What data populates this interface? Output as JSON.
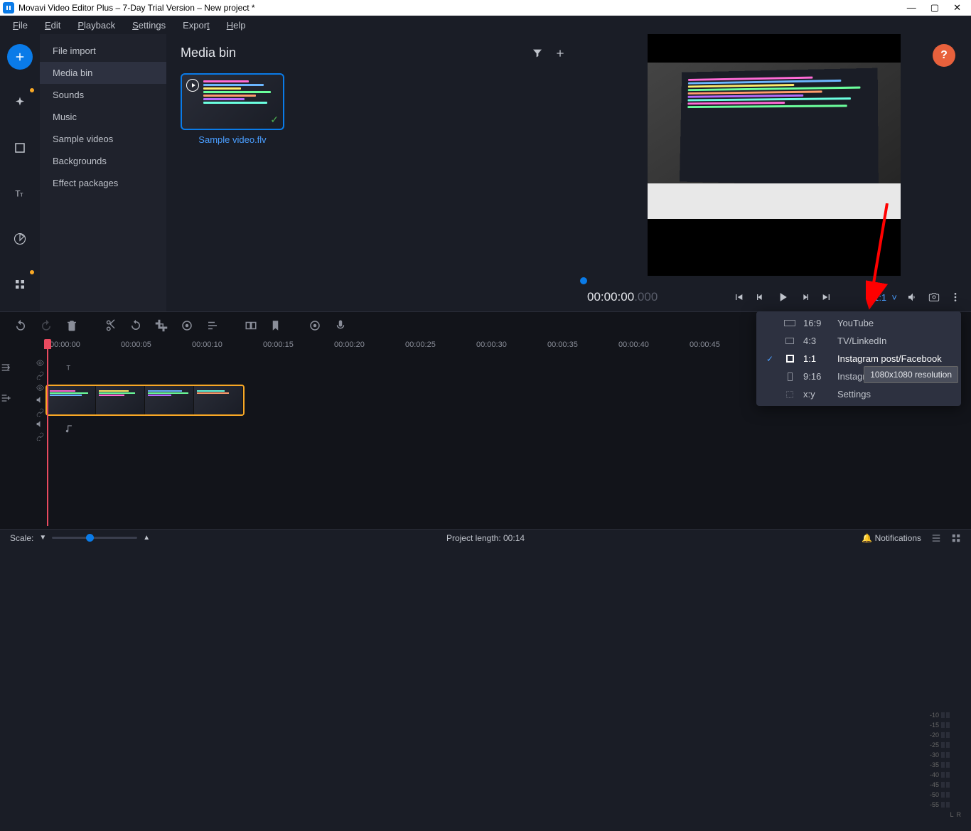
{
  "titlebar": {
    "title": "Movavi Video Editor Plus – 7-Day Trial Version – New project *"
  },
  "menu": {
    "file": "File",
    "edit": "Edit",
    "playback": "Playback",
    "settings": "Settings",
    "export": "Export",
    "help": "Help"
  },
  "sidepanel": {
    "items": [
      "File import",
      "Media bin",
      "Sounds",
      "Music",
      "Sample videos",
      "Backgrounds",
      "Effect packages"
    ],
    "selected": 1
  },
  "content": {
    "heading": "Media bin",
    "thumb_label": "Sample video.flv"
  },
  "preview": {
    "time": "00:00:00",
    "ms": ".000",
    "ratio_label": "1:1"
  },
  "aspect_menu": {
    "items": [
      {
        "ratio": "16:9",
        "label": "YouTube",
        "w": 16,
        "h": 9
      },
      {
        "ratio": "4:3",
        "label": "TV/LinkedIn",
        "w": 12,
        "h": 9
      },
      {
        "ratio": "1:1",
        "label": "Instagram post/Facebook",
        "w": 10,
        "h": 10,
        "selected": true
      },
      {
        "ratio": "9:16",
        "label": "Instagram story/TikTok",
        "w": 7,
        "h": 12
      },
      {
        "ratio": "x:y",
        "label": "Settings",
        "settings": true
      }
    ]
  },
  "tooltip": "1080x1080 resolution",
  "timeline": {
    "ticks": [
      "00:00:00",
      "00:00:05",
      "00:00:10",
      "00:00:15",
      "00:00:20",
      "00:00:25",
      "00:00:30",
      "00:00:35",
      "00:00:40",
      "00:00:45"
    ]
  },
  "statusbar": {
    "scale_label": "Scale:",
    "project_length": "Project length:  00:14",
    "notifications": "Notifications"
  },
  "meter": {
    "labels": [
      "-10",
      "-15",
      "-20",
      "-25",
      "-30",
      "-35",
      "-40",
      "-45",
      "-50",
      "-55"
    ],
    "lr": [
      "L",
      "R"
    ]
  },
  "help": "?"
}
